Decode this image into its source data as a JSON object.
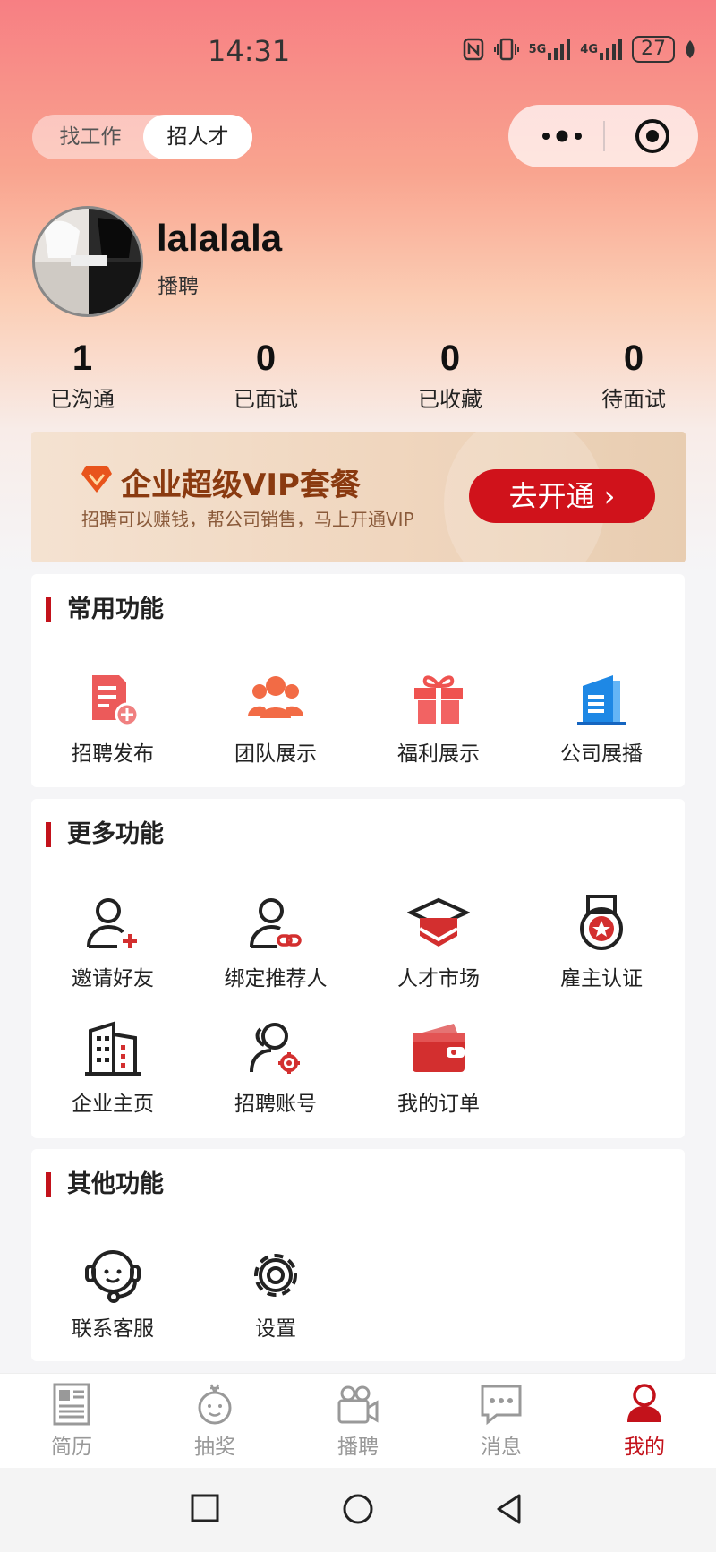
{
  "status_bar": {
    "time": "14:31",
    "network_1": "5G",
    "network_2": "4G",
    "battery": "27"
  },
  "mode_toggle": {
    "find_job": "找工作",
    "recruit": "招人才"
  },
  "profile": {
    "username": "lalalala",
    "subtitle": "播聘"
  },
  "stats": [
    {
      "value": "1",
      "label": "已沟通"
    },
    {
      "value": "0",
      "label": "已面试"
    },
    {
      "value": "0",
      "label": "已收藏"
    },
    {
      "value": "0",
      "label": "待面试"
    }
  ],
  "vip": {
    "title": "企业超级VIP套餐",
    "description": "招聘可以赚钱，帮公司销售，马上开通VIP",
    "button": "去开通 ›"
  },
  "common": {
    "title": "常用功能",
    "items": [
      {
        "label": "招聘发布",
        "icon": "document-add-icon"
      },
      {
        "label": "团队展示",
        "icon": "team-icon"
      },
      {
        "label": "福利展示",
        "icon": "gift-icon"
      },
      {
        "label": "公司展播",
        "icon": "building-icon"
      }
    ]
  },
  "more": {
    "title": "更多功能",
    "items": [
      {
        "label": "邀请好友",
        "icon": "add-user-icon"
      },
      {
        "label": "绑定推荐人",
        "icon": "link-user-icon"
      },
      {
        "label": "人才市场",
        "icon": "graduation-cap-icon"
      },
      {
        "label": "雇主认证",
        "icon": "medal-icon"
      },
      {
        "label": "企业主页",
        "icon": "office-building-icon"
      },
      {
        "label": "招聘账号",
        "icon": "user-settings-icon"
      },
      {
        "label": "我的订单",
        "icon": "wallet-icon"
      }
    ]
  },
  "other": {
    "title": "其他功能",
    "items": [
      {
        "label": "联系客服",
        "icon": "headset-icon"
      },
      {
        "label": "设置",
        "icon": "gear-icon"
      }
    ]
  },
  "tabbar": [
    {
      "label": "简历",
      "icon": "resume-icon",
      "active": false
    },
    {
      "label": "抽奖",
      "icon": "lottery-icon",
      "active": false
    },
    {
      "label": "播聘",
      "icon": "video-camera-icon",
      "active": false
    },
    {
      "label": "消息",
      "icon": "message-icon",
      "active": false
    },
    {
      "label": "我的",
      "icon": "profile-icon",
      "active": true
    }
  ],
  "colors": {
    "accent": "#c3121b",
    "vip_button": "#d0121b",
    "vip_title": "#8a3a10"
  }
}
